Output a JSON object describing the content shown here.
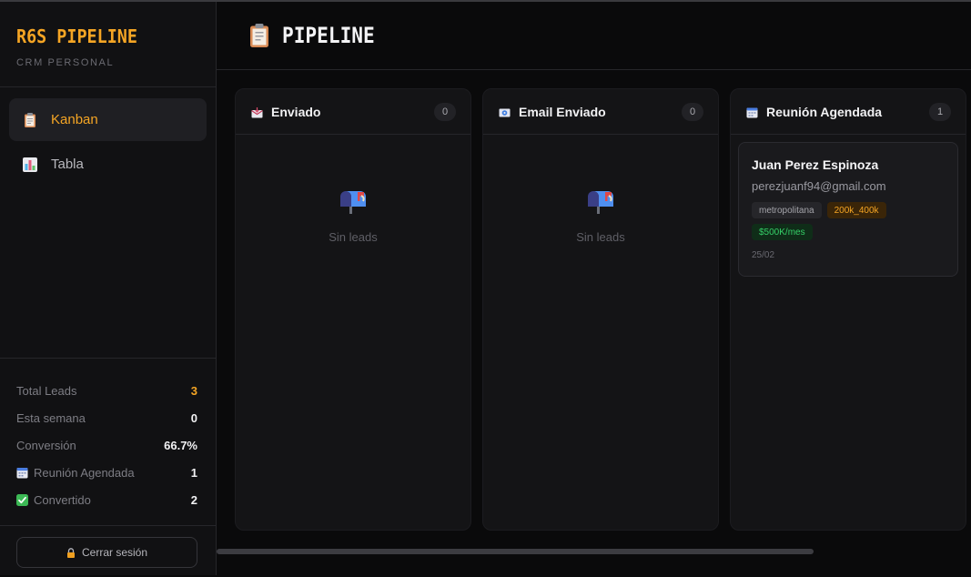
{
  "app": {
    "title": "R6S PIPELINE",
    "subtitle": "CRM PERSONAL"
  },
  "sidebar": {
    "nav": [
      {
        "label": "Kanban",
        "icon": "clipboard-icon",
        "active": true
      },
      {
        "label": "Tabla",
        "icon": "bar-chart-icon",
        "active": false
      }
    ],
    "stats": [
      {
        "label": "Total Leads",
        "value": "3"
      },
      {
        "label": "Esta semana",
        "value": "0"
      },
      {
        "label": "Conversión",
        "value": "66.7%"
      },
      {
        "label": "Reunión Agendada",
        "value": "1",
        "icon": "calendar-icon"
      },
      {
        "label": "Convertido",
        "value": "2",
        "icon": "check-icon"
      }
    ],
    "logout_label": "Cerrar sesión"
  },
  "header": {
    "title": "PIPELINE",
    "icon": "clipboard-icon"
  },
  "columns": [
    {
      "title": "Enviado",
      "count": "0",
      "icon": "envelope-icon",
      "empty_text": "Sin leads"
    },
    {
      "title": "Email Enviado",
      "count": "0",
      "icon": "email-icon",
      "empty_text": "Sin leads"
    },
    {
      "title": "Reunión Agendada",
      "count": "1",
      "icon": "calendar-icon",
      "cards": [
        {
          "name": "Juan Perez Espinoza",
          "email": "perezjuanf94@gmail.com",
          "tags": [
            "metropolitana",
            "200k_400k",
            "$500K/mes"
          ],
          "date": "25/02"
        }
      ]
    }
  ],
  "colors": {
    "accent": "#f5a524",
    "tag_orange_bg": "#3a2508",
    "tag_green": "#35d068",
    "background": "#0a0a0b"
  }
}
